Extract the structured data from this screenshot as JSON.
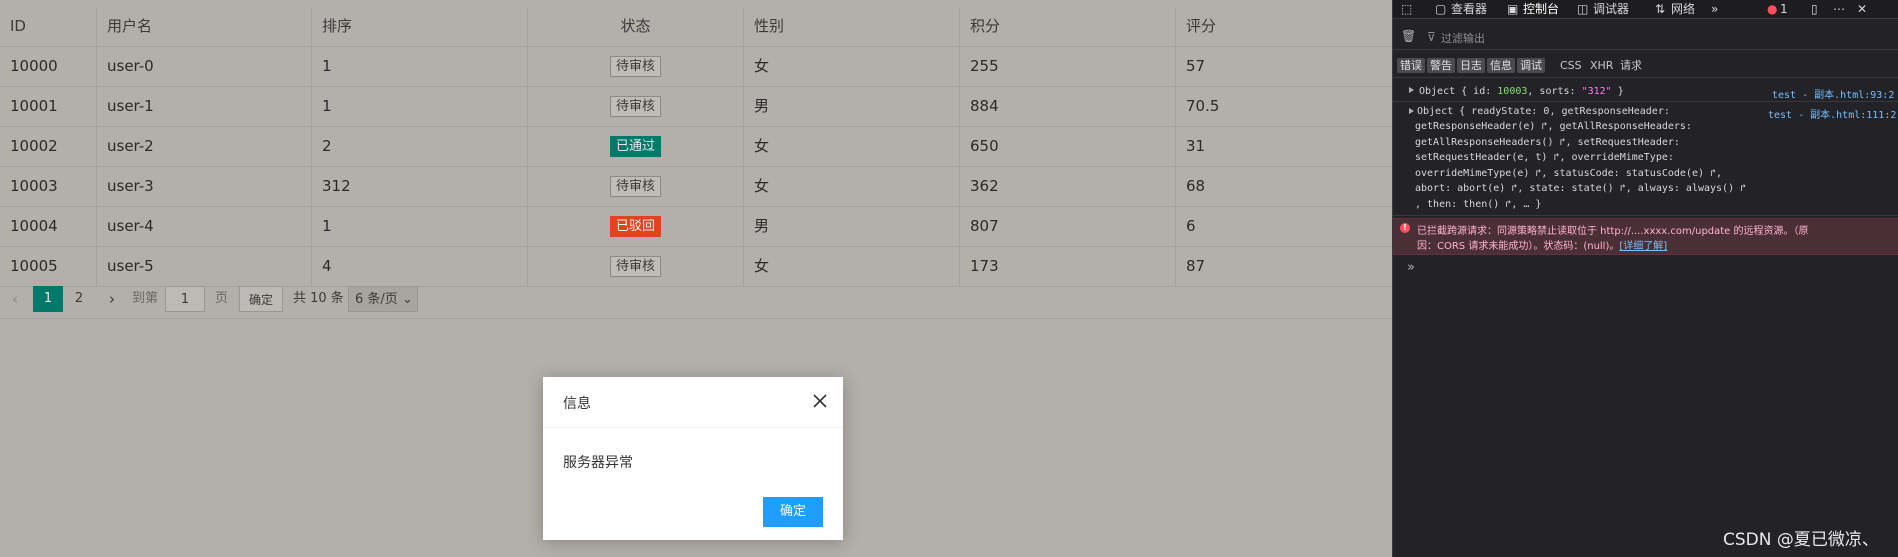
{
  "table": {
    "columns": [
      "ID",
      "用户名",
      "排序",
      "状态",
      "性别",
      "积分",
      "评分"
    ],
    "rows": [
      {
        "id": "10000",
        "name": "user-0",
        "sort": "1",
        "status": "待审核",
        "gender": "女",
        "score": "255",
        "rate": "57"
      },
      {
        "id": "10001",
        "name": "user-1",
        "sort": "1",
        "status": "待审核",
        "gender": "男",
        "score": "884",
        "rate": "70.5"
      },
      {
        "id": "10002",
        "name": "user-2",
        "sort": "2",
        "status": "已通过",
        "gender": "女",
        "score": "650",
        "rate": "31"
      },
      {
        "id": "10003",
        "name": "user-3",
        "sort": "312",
        "status": "待审核",
        "gender": "女",
        "score": "362",
        "rate": "68"
      },
      {
        "id": "10004",
        "name": "user-4",
        "sort": "1",
        "status": "已驳回",
        "gender": "男",
        "score": "807",
        "rate": "6"
      },
      {
        "id": "10005",
        "name": "user-5",
        "sort": "4",
        "status": "待审核",
        "gender": "女",
        "score": "173",
        "rate": "87"
      }
    ]
  },
  "pager": {
    "prev": "‹",
    "pages": [
      "1",
      "2"
    ],
    "next": "›",
    "goto_label": "到第",
    "goto_value": "1",
    "page_unit": "页",
    "confirm": "确定",
    "total": "共 10 条",
    "page_size": "6 条/页"
  },
  "modal": {
    "title": "信息",
    "message": "服务器异常",
    "ok": "确定"
  },
  "devtools": {
    "tabs": {
      "inspector": "查看器",
      "console": "控制台",
      "debugger": "调试器",
      "network": "网络",
      "error_count": "1"
    },
    "filter_placeholder": "过滤输出",
    "levels": [
      "错误",
      "警告",
      "日志",
      "信息",
      "调试"
    ],
    "filters": [
      "CSS",
      "XHR",
      "请求"
    ],
    "log1": {
      "text_parts": [
        "Object { id: ",
        "10003",
        ", sorts: ",
        "\"312\"",
        " }"
      ],
      "source": "test - 副本.html:93:2"
    },
    "log2": {
      "lines": [
        "Object { readyState: 0, getResponseHeader:",
        "getResponseHeader(e) ↱, getAllResponseHeaders:",
        "getAllResponseHeaders() ↱, setRequestHeader:",
        "setRequestHeader(e, t) ↱, overrideMimeType:",
        "overrideMimeType(e) ↱, statusCode: statusCode(e) ↱,",
        "abort: abort(e) ↱, state: state() ↱, always: always() ↱",
        ", then: then() ↱, … }"
      ],
      "source": "test - 副本.html:111:2"
    },
    "error": {
      "line1": "已拦截跨源请求：同源策略禁止读取位于 http://....xxxx.com/update 的远程资源。（原",
      "line2": "因：CORS 请求未能成功）。状态码：(null)。",
      "link": "[详细了解]"
    },
    "prompt": "»",
    "watermark": "CSDN @夏已微凉、"
  },
  "colors": {
    "pass_badge": "#00796b",
    "reject_badge": "#e0431e",
    "active_page": "#00796b",
    "modal_ok": "#1e9fff",
    "devtools_bg": "#232327"
  }
}
